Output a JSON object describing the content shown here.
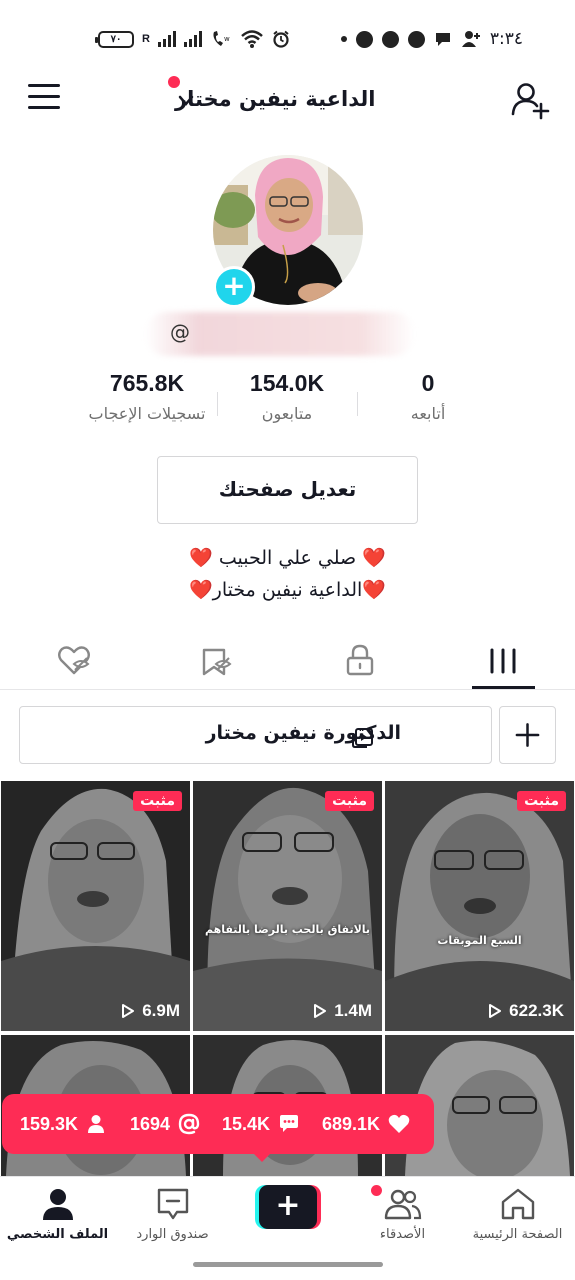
{
  "status_bar": {
    "time": "٣:٣٤",
    "battery": "٧٠",
    "network": "R"
  },
  "header": {
    "title": "الداعية نيفين مختار"
  },
  "profile": {
    "username": "@",
    "stats": {
      "following_count": "0",
      "following_label": "أتابعه",
      "followers_count": "154.0K",
      "followers_label": "متابعون",
      "likes_count": "765.8K",
      "likes_label": "تسجيلات الإعجاب"
    },
    "edit_button": "تعديل صفحتك",
    "bio_line1": "❤️ صلي علي الحبيب ❤️",
    "bio_line2": "❤️الداعية نيفين مختار❤️"
  },
  "collection": {
    "label": "الدكتورة نيفين مختار"
  },
  "videos": [
    {
      "views": "622.3K",
      "badge": "مثبت",
      "caption": "السبع الموبقات"
    },
    {
      "views": "1.4M",
      "badge": "مثبت",
      "caption": "بالاتفاق بالحب بالرضا بالتفاهم"
    },
    {
      "views": "6.9M",
      "badge": "مثبت",
      "caption": ""
    }
  ],
  "popup": {
    "likes": "689.1K",
    "comments": "15.4K",
    "mentions": "1694",
    "profile_views": "159.3K"
  },
  "bottom_nav": {
    "home": "الصفحة الرئيسية",
    "friends": "الأصدقاء",
    "inbox": "صندوق الوارد",
    "profile": "الملف الشخصي"
  },
  "colors": {
    "accent": "#fe2c55",
    "cyan": "#25f4ee",
    "text": "#161823"
  }
}
